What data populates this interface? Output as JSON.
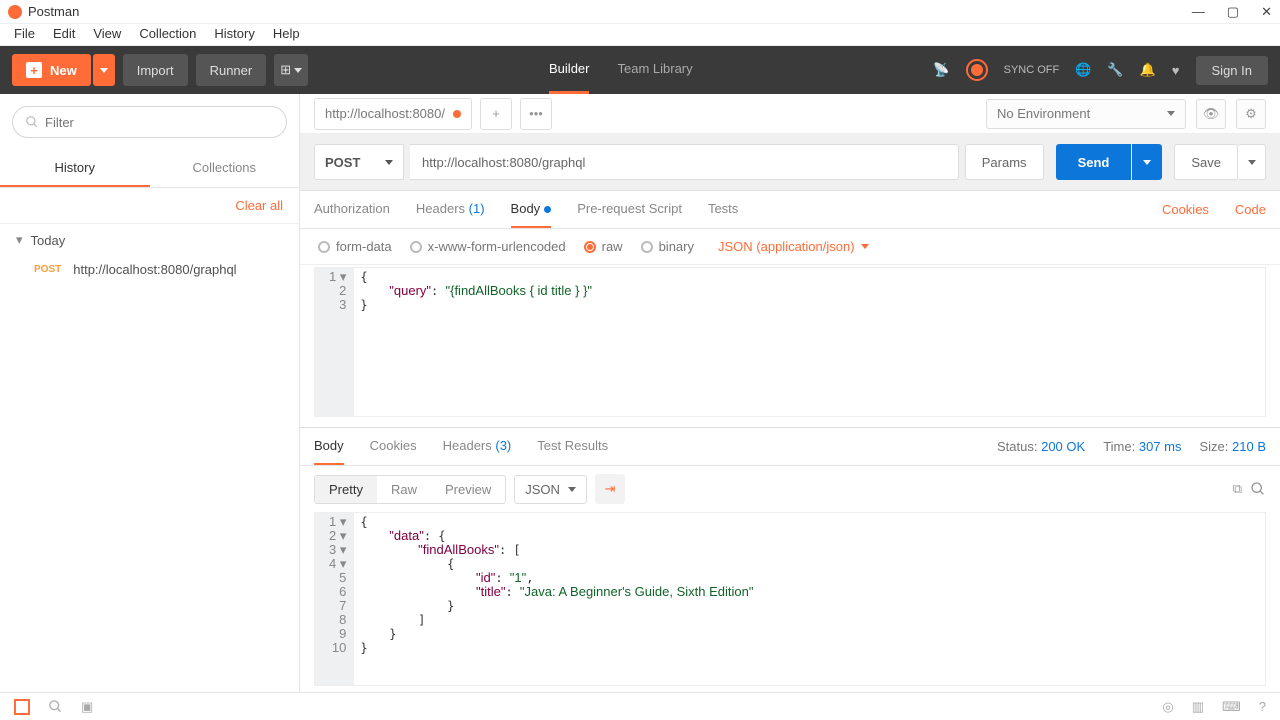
{
  "window": {
    "title": "Postman"
  },
  "menubar": [
    "File",
    "Edit",
    "View",
    "Collection",
    "History",
    "Help"
  ],
  "toolbar": {
    "new_label": "New",
    "import_label": "Import",
    "runner_label": "Runner",
    "center": [
      {
        "label": "Builder",
        "active": true
      },
      {
        "label": "Team Library",
        "active": false
      }
    ],
    "sync_label": "SYNC OFF",
    "signin_label": "Sign In"
  },
  "sidebar": {
    "filter_placeholder": "Filter",
    "tabs": [
      {
        "label": "History",
        "active": true
      },
      {
        "label": "Collections",
        "active": false
      }
    ],
    "clear_label": "Clear all",
    "today_label": "Today",
    "items": [
      {
        "method": "POST",
        "url": "http://localhost:8080/graphql"
      }
    ]
  },
  "env": {
    "label": "No Environment"
  },
  "request_tab": {
    "title": "http://localhost:8080/"
  },
  "request": {
    "method": "POST",
    "url": "http://localhost:8080/graphql",
    "params_label": "Params",
    "send_label": "Send",
    "save_label": "Save"
  },
  "req_tabs": {
    "auth": "Authorization",
    "headers": "Headers",
    "headers_count": "(1)",
    "body": "Body",
    "prereq": "Pre-request Script",
    "tests": "Tests",
    "cookies": "Cookies",
    "code": "Code"
  },
  "body_opts": {
    "formdata": "form-data",
    "urlenc": "x-www-form-urlencoded",
    "raw": "raw",
    "binary": "binary",
    "content_type": "JSON (application/json)"
  },
  "req_body_lines": [
    "{",
    "    \"query\":\"{findAllBooks { id title } }\"",
    "}"
  ],
  "response": {
    "tabs": {
      "body": "Body",
      "cookies": "Cookies",
      "headers": "Headers",
      "headers_count": "(3)",
      "tests": "Test Results"
    },
    "status_label": "Status:",
    "status_val": "200 OK",
    "time_label": "Time:",
    "time_val": "307 ms",
    "size_label": "Size:",
    "size_val": "210 B",
    "view": {
      "pretty": "Pretty",
      "raw": "Raw",
      "preview": "Preview",
      "format": "JSON"
    },
    "lines": [
      "{",
      "    \"data\": {",
      "        \"findAllBooks\": [",
      "            {",
      "                \"id\": \"1\",",
      "                \"title\": \"Java: A Beginner's Guide, Sixth Edition\"",
      "            }",
      "        ]",
      "    }",
      "}"
    ]
  }
}
